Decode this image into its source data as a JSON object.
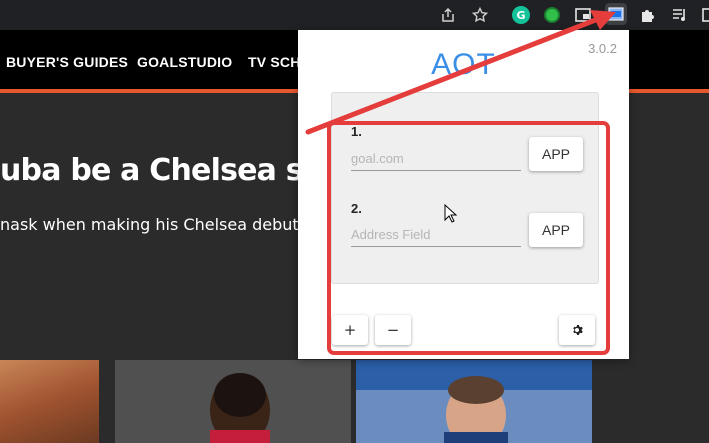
{
  "browser": {
    "icons": [
      "share-icon",
      "star-icon",
      "grammarly-icon",
      "extension-green-icon",
      "picture-in-picture-icon",
      "aot-extension-icon",
      "puzzle-icon",
      "media-queue-icon",
      "window-icon"
    ]
  },
  "site": {
    "nav": [
      "BUYER'S GUIDES",
      "GOALSTUDIO",
      "TV SCH"
    ],
    "accent_color": "#e8582f",
    "headline": "uba be a Chelsea supe",
    "subtext": "nask when making his Chelsea debut, bu"
  },
  "popup": {
    "version": "3.0.2",
    "title": "AOT",
    "items": [
      {
        "number": "1.",
        "value": "goal.com",
        "placeholder": "goal.com",
        "button": "APP"
      },
      {
        "number": "2.",
        "value": "",
        "placeholder": "Address Field",
        "button": "APP"
      }
    ],
    "add_label": "+",
    "remove_label": "−",
    "settings_icon": "gear-icon",
    "title_color": "#3b8ee6"
  },
  "annotation": {
    "color": "#e53c3c"
  }
}
